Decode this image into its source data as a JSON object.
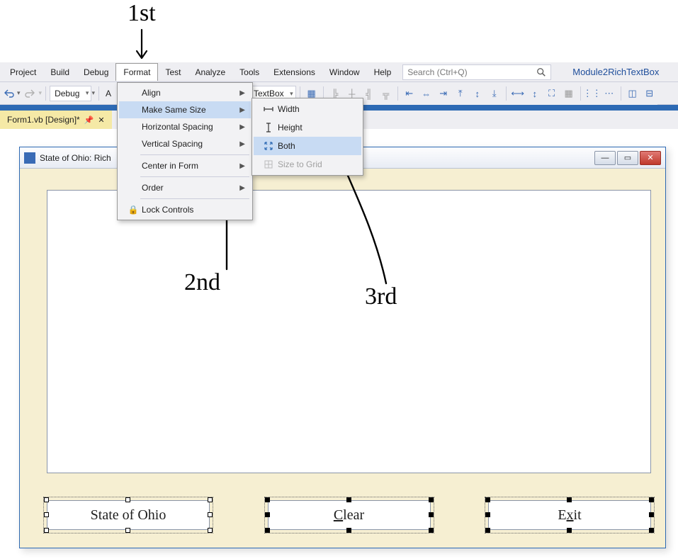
{
  "menubar": {
    "items": [
      "Project",
      "Build",
      "Debug",
      "Format",
      "Test",
      "Analyze",
      "Tools",
      "Extensions",
      "Window",
      "Help"
    ],
    "open_index": 3,
    "search_placeholder": "Search (Ctrl+Q)",
    "project_name": "Module2RichTextBox"
  },
  "toolbar": {
    "config": "Debug",
    "extra_label_truncated": "A",
    "control_dropdown_truncated": "TextBox"
  },
  "doc_tab": {
    "label": "Form1.vb [Design]*"
  },
  "dropdown_format": {
    "items": [
      {
        "label": "Align",
        "has_sub": true
      },
      {
        "label": "Make Same Size",
        "has_sub": true,
        "highlight": true
      },
      {
        "label": "Horizontal Spacing",
        "has_sub": true
      },
      {
        "label": "Vertical Spacing",
        "has_sub": true
      },
      {
        "label": "Center in Form",
        "has_sub": true
      },
      {
        "label": "Order",
        "has_sub": true
      },
      {
        "label": "Lock Controls",
        "has_sub": false,
        "icon": "lock"
      }
    ]
  },
  "dropdown_sub": {
    "items": [
      {
        "label": "Width",
        "icon": "width"
      },
      {
        "label": "Height",
        "icon": "height"
      },
      {
        "label": "Both",
        "icon": "both",
        "highlight": true
      },
      {
        "label": "Size to Grid",
        "icon": "grid",
        "disabled": true
      }
    ]
  },
  "form": {
    "title_truncated": "State of Ohio: Rich",
    "buttons": [
      {
        "label": "State of Ohio",
        "primary": true
      },
      {
        "label": "Clear",
        "underline": "C"
      },
      {
        "label": "Exit",
        "underline": "x"
      }
    ]
  },
  "annotations": {
    "first": "1st",
    "second": "2nd",
    "third": "3rd"
  }
}
